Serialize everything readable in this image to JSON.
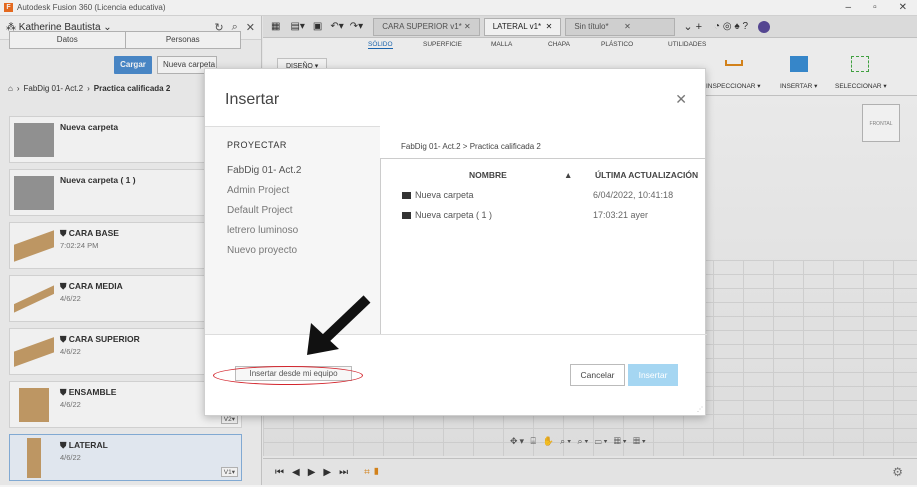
{
  "window": {
    "title": "Autodesk Fusion 360 (Licencia educativa)"
  },
  "sidebar": {
    "user": "Katherine Bautista",
    "tabs": [
      "Datos",
      "Personas"
    ],
    "upload_label": "Cargar",
    "new_folder_label": "Nueva carpeta",
    "breadcrumb": [
      "FabDig 01- Act.2",
      "Practica calificada 2"
    ],
    "items": [
      {
        "name": "Nueva carpeta",
        "date": "",
        "type": "folder",
        "version": ""
      },
      {
        "name": "Nueva carpeta ( 1 )",
        "date": "",
        "type": "folder",
        "version": ""
      },
      {
        "name": "CARA BASE",
        "date": "7:02:24 PM",
        "type": "design",
        "version": ""
      },
      {
        "name": "CARA MEDIA",
        "date": "4/6/22",
        "type": "design",
        "version": ""
      },
      {
        "name": "CARA SUPERIOR",
        "date": "4/6/22",
        "type": "design",
        "version": ""
      },
      {
        "name": "ENSAMBLE",
        "date": "4/6/22",
        "type": "design",
        "version": "V2"
      },
      {
        "name": "LATERAL",
        "date": "4/6/22",
        "type": "design",
        "version": "V1"
      }
    ]
  },
  "doc_tabs": [
    "CARA SUPERIOR v1*",
    "LATERAL v1*",
    "Sin título*"
  ],
  "ribbon": {
    "tabs": [
      "SÓLIDO",
      "SUPERFICIE",
      "MALLA",
      "CHAPA",
      "PLÁSTICO",
      "UTILIDADES"
    ],
    "workspace": "DISEÑO",
    "groups": [
      "INSPECCIONAR",
      "INSERTAR",
      "SELECCIONAR"
    ]
  },
  "viewcube_label": "FRONTAL",
  "dialog": {
    "title": "Insertar",
    "projects_header": "PROYECTAR",
    "projects": [
      "FabDig 01- Act.2",
      "Admin Project",
      "Default Project",
      "letrero luminoso",
      "Nuevo proyecto"
    ],
    "breadcrumb": "FabDig 01- Act.2 > Practica calificada 2",
    "columns": {
      "name": "NOMBRE",
      "updated": "ÚLTIMA ACTUALIZACIÓN"
    },
    "files": [
      {
        "name": "Nueva carpeta",
        "updated": "6/04/2022, 10:41:18"
      },
      {
        "name": "Nueva carpeta ( 1 )",
        "updated": "17:03:21 ayer"
      }
    ],
    "insert_from_pc": "Insertar desde mi equipo",
    "cancel": "Cancelar",
    "insert": "Insertar"
  }
}
